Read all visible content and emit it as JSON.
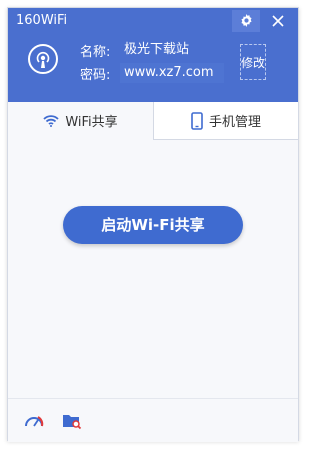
{
  "app": {
    "title": "160WiFi"
  },
  "header": {
    "name_label": "名称:",
    "name_value": "极光下载站",
    "password_label": "密码:",
    "password_value": "www.xz7.com",
    "edit_label": "修改"
  },
  "tabs": [
    {
      "label": "WiFi共享",
      "icon": "wifi-icon",
      "active": true
    },
    {
      "label": "手机管理",
      "icon": "phone-icon",
      "active": false
    }
  ],
  "main": {
    "start_button_label": "启动Wi-Fi共享"
  },
  "footer": {
    "icons": [
      "speedometer-icon",
      "folder-search-icon"
    ]
  },
  "colors": {
    "header_bg": "#4a6fcf",
    "button_bg": "#3f6bd0",
    "content_bg": "#f7f8fb"
  }
}
